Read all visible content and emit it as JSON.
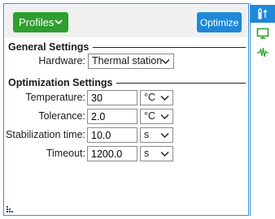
{
  "toolbar": {
    "profiles_label": "Profiles",
    "optimize_label": "Optimize"
  },
  "general": {
    "title": "General Settings",
    "hardware_label": "Hardware:",
    "hardware_value": "Thermal station"
  },
  "optimization": {
    "title": "Optimization Settings",
    "temperature": {
      "label": "Temperature:",
      "value": "30",
      "unit": "°C"
    },
    "tolerance": {
      "label": "Tolerance:",
      "value": "2.0",
      "unit": "°C"
    },
    "stabilization": {
      "label": "Stabilization time:",
      "value": "10.0",
      "unit": "s"
    },
    "timeout": {
      "label": "Timeout:",
      "value": "1200.0",
      "unit": "s"
    }
  },
  "sidebar": {
    "tabs": [
      {
        "icon": "thermometer-icon",
        "active": true
      },
      {
        "icon": "monitor-icon",
        "active": false
      },
      {
        "icon": "waveform-icon",
        "active": false
      }
    ]
  },
  "colors": {
    "accent": "#1f88d8",
    "green": "#2e9e2e",
    "border": "#3a8fd9"
  }
}
